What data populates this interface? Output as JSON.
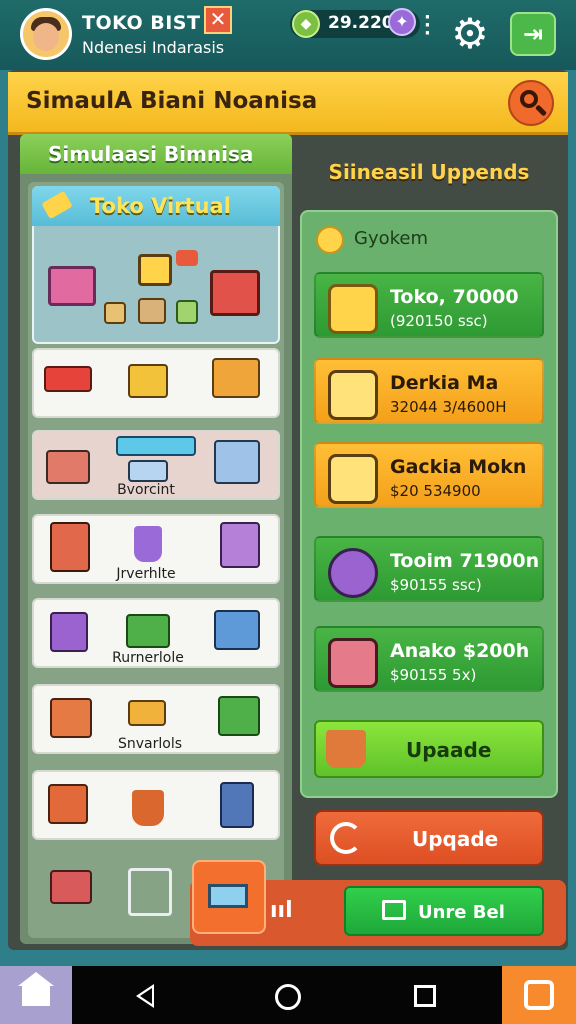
{
  "header": {
    "app_title": "TOKO BIST",
    "app_subtitle": "Ndenesi Indarasis",
    "currency_value": "29.220",
    "close_label": "✕",
    "coin_glyph": "◆",
    "gem_glyph": "✦",
    "settings_icon": "gear-icon",
    "exit_icon": "exit-icon"
  },
  "banner": {
    "title": "SimaulA Biani Noanisa"
  },
  "left_panel": {
    "tab_label": "Simulaasi Bimnisa",
    "toko_title": "Toko Virtual",
    "rows": [
      {
        "label": ""
      },
      {
        "label": "Bvorcint"
      },
      {
        "label": "Jrverhlte"
      },
      {
        "label": "Rurnerlole"
      },
      {
        "label": "Snvarlols"
      },
      {
        "label": ""
      }
    ]
  },
  "right_panel": {
    "heading": "Siineasil Uppends",
    "category": "Gyokem",
    "upgrades": [
      {
        "title": "Toko, 70000",
        "price": "(920150 ssc)",
        "variant": "green"
      },
      {
        "title": "Derkia Ma",
        "price": "32044 3/4600H",
        "variant": "orange"
      },
      {
        "title": "Gackia Mokn",
        "price": "$20 534900",
        "variant": "orange"
      },
      {
        "title": "Tooim 71900n",
        "price": "$90155 ssc)",
        "variant": "green"
      },
      {
        "title": "Anako $200h",
        "price": "$90155 5x)",
        "variant": "green"
      }
    ],
    "upade_label": "Upaade"
  },
  "upgrade_button": {
    "label": "Upqade"
  },
  "buy_button": {
    "label": "Unre Bel",
    "signal": "ııl"
  },
  "colors": {
    "brand_green": "#4cb84a",
    "accent_yellow": "#ffd34a",
    "accent_orange": "#f06a2b"
  }
}
